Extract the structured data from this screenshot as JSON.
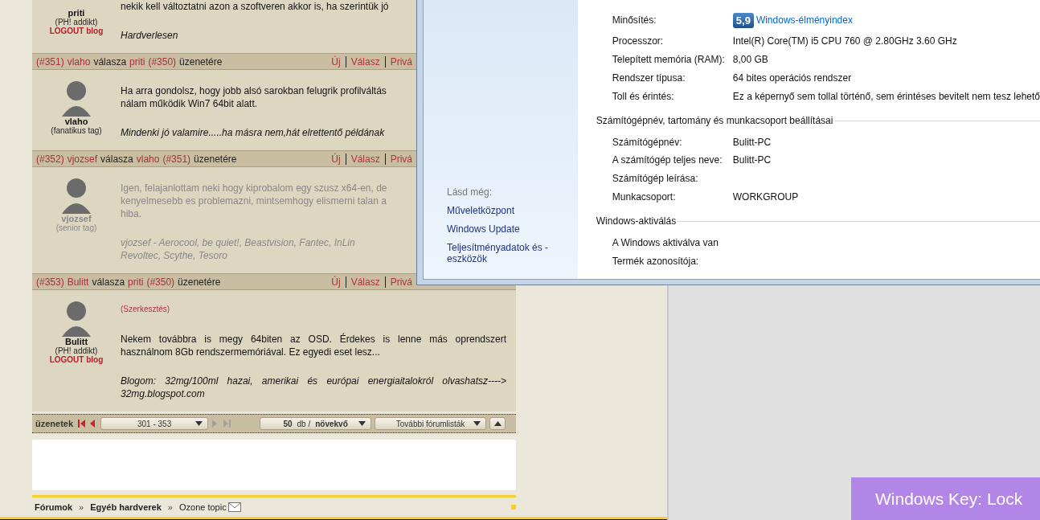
{
  "forum": {
    "posts": [
      {
        "author": "priti",
        "rank": "(PH! addikt)",
        "blog": "LOGOUT blog",
        "dimmed": false,
        "body": [
          "nekik kell változtatni azon a szoftveren akkor is, ha szerintük jó"
        ],
        "signature": [
          "Hardverlesen"
        ]
      },
      {
        "header": {
          "number": "(#351)",
          "author": "vlaho",
          "verb": "válasza",
          "target": "priti",
          "target_number": "(#350)",
          "suffix": "üzenetére",
          "actions": [
            "Új",
            "Válasz",
            "Privá"
          ]
        },
        "author": "vlaho",
        "rank": "(fanatikus tag)",
        "dimmed": false,
        "body": [
          "Ha arra gondolsz, hogy jobb alsó sarokban felugrik profilváltás",
          "nálam működik Win7 64bit alatt."
        ],
        "signature": [
          "Mindenki jó valamire.....ha másra nem,hát elrettentő példának"
        ]
      },
      {
        "header": {
          "number": "(#352)",
          "author": "vjozsef",
          "verb": "válasza",
          "target": "vlaho",
          "target_number": "(#351)",
          "suffix": "üzenetére",
          "actions": [
            "Új",
            "Válasz",
            "Privá"
          ]
        },
        "author": "vjozsef",
        "rank": "(senior tag)",
        "dimmed": true,
        "body": [
          "Igen, felajanlottam neki hogy kiprobalom egy szusz x64-en, de",
          "kenyelmesebb es problemazni, mintsemhogy elismerni talan a",
          "hiba."
        ],
        "signature": [
          "vjozsef - Aerocool, be quiet!, Beastvision, Fantec, InLin",
          "Revoltec, Scythe, Tesoro"
        ]
      },
      {
        "header": {
          "number": "(#353)",
          "author": "Bulitt",
          "verb": "válasza",
          "target": "priti",
          "target_number": "(#350)",
          "suffix": "üzenetére",
          "actions": [
            "Új",
            "Válasz",
            "Privá"
          ]
        },
        "author": "Bulitt",
        "rank": "(PH! addikt)",
        "blog": "LOGOUT blog",
        "dimmed": false,
        "edit_note": "(Szerkesztés)",
        "body": [
          "Nekem továbbra is megy 64biten az OSD. Érdekes is lenne más oprendszert",
          "használnom 8Gb rendszermemóriával. Ez egyedi eset lesz..."
        ],
        "signature": [
          "Blogom: 32mg/100ml hazai, amerikai és európai energiaitalokról olvashatsz---->",
          "32mg.blogspot.com"
        ]
      }
    ],
    "nav": {
      "label": "üzenetek",
      "buttons": [
        {
          "kind": "first",
          "disabled": false
        },
        {
          "kind": "prev",
          "disabled": false
        },
        {
          "kind": "next",
          "disabled": true
        },
        {
          "kind": "last",
          "disabled": true
        }
      ],
      "range": "301 - 353",
      "sort": "**50** db / **növekvő**",
      "more": "További fórumlisták"
    },
    "breadcrumb": [
      {
        "kind": "link",
        "label": "Fórumok",
        "bold": true
      },
      {
        "kind": "separator",
        "label": "»"
      },
      {
        "kind": "link",
        "label": "Egyéb hardverek",
        "bold": true
      },
      {
        "kind": "separator",
        "label": "»"
      },
      {
        "kind": "link",
        "label": "Ozone topic",
        "bold": false
      }
    ]
  },
  "window": {
    "see_also_title": "Lásd még:",
    "see_also": [
      "Műveletközpont",
      "Windows Update",
      "Teljesítményadatok és -eszközök"
    ],
    "rating": {
      "label": "Minősítés:",
      "score": "5,9",
      "link": "Windows-élményindex"
    },
    "sections": [
      {
        "rows": [
          {
            "label": "Processzor:",
            "value": "Intel(R) Core(TM) i5 CPU       760  @ 2.80GHz   3.60 GHz"
          },
          {
            "label": "Telepített memória (RAM):",
            "value": "8,00 GB"
          },
          {
            "label": "Rendszer típusa:",
            "value": "64 bites operációs rendszer"
          },
          {
            "label": "Toll és érintés:",
            "value": "Ez a képernyő sem tollal történő, sem érintéses bevitelt nem tesz lehető"
          }
        ]
      },
      {
        "title": "Számítógépnév, tartomány és munkacsoport beállításai",
        "rows": [
          {
            "label": "Számítógépnév:",
            "value": "Bulitt-PC"
          },
          {
            "label": "A számítógép teljes neve:",
            "value": "Bulitt-PC"
          },
          {
            "label": "Számítógép leírása:"
          },
          {
            "label": "Munkacsoport:",
            "value": "WORKGROUP"
          }
        ]
      },
      {
        "title": "Windows-aktiválás",
        "rows": [
          {
            "label": "A Windows aktiválva van"
          },
          {
            "label": "Termék azonosítója:"
          }
        ]
      }
    ]
  },
  "osd": {
    "text": "Windows Key: Lock"
  }
}
